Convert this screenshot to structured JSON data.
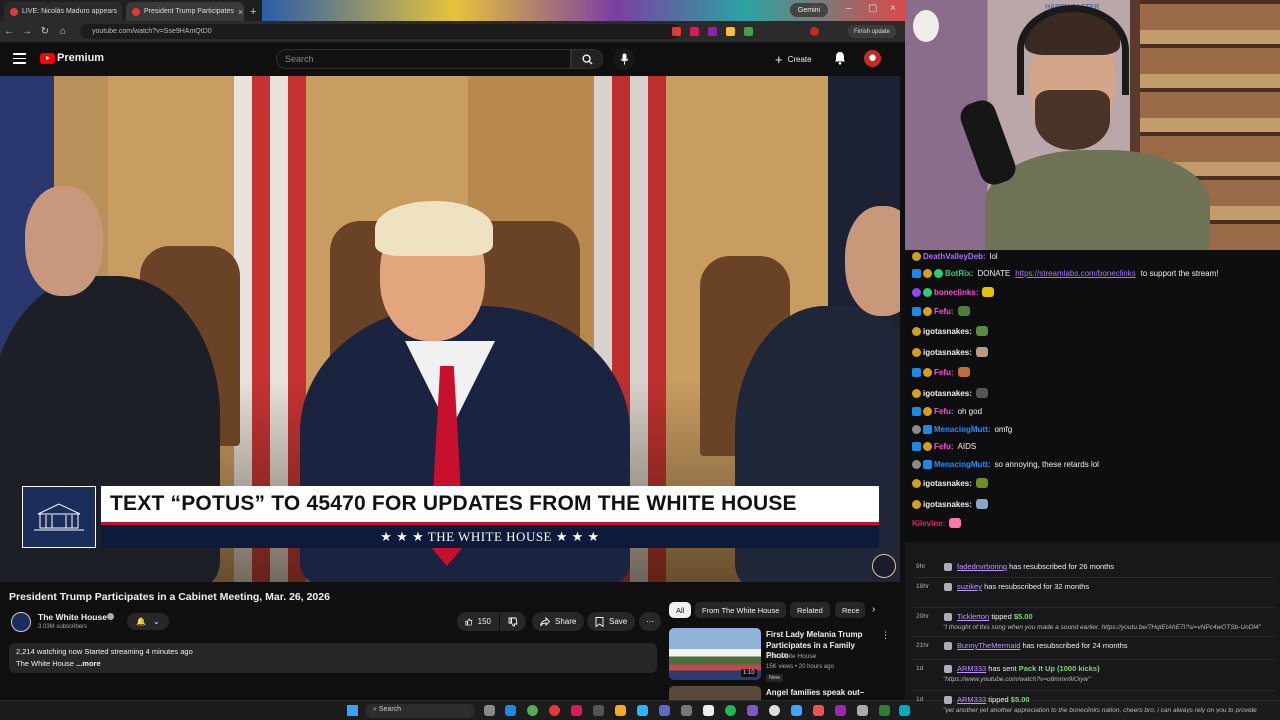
{
  "browser": {
    "tabs": [
      {
        "label": "LIVE: Nicolás Maduro appears",
        "active": false
      },
      {
        "label": "President Trump Participates",
        "active": true
      }
    ],
    "url": "youtube.com/watch?v=Sse9HAmQtD0",
    "gemini_label": "Gemini",
    "finish_update_label": "Finish update"
  },
  "youtube": {
    "brand": "Premium",
    "search_placeholder": "Search",
    "create_label": "Create"
  },
  "video": {
    "banner_text": "TEXT “POTUS” TO 45470 FOR UPDATES FROM THE WHITE HOUSE",
    "banner_subtext": "★ ★ ★   THE WHITE HOUSE   ★ ★ ★",
    "title": "President Trump Participates in a Cabinet Meeting, Mar. 26, 2026",
    "channel": "The White House",
    "subscribers": "3.03M subscribers",
    "like_count": "150",
    "share_label": "Share",
    "save_label": "Save",
    "watching": "2,214 watching now  Started streaming 4 minutes ago",
    "desc_channel": "The White House",
    "desc_more": "...more"
  },
  "related": {
    "chips": [
      "All",
      "From The White House",
      "Related",
      "Rece"
    ],
    "items": [
      {
        "title": "First Lady Melania Trump Participates in a Family Photo",
        "channel": "The White House",
        "meta": "15K views • 20 hours ago",
        "badge": "New",
        "duration": "1:10"
      },
      {
        "title": "Angel families speak out–"
      }
    ]
  },
  "taskbar": {
    "search_label": "Search"
  },
  "webcam": {
    "sign": "HAPPY EASTER"
  },
  "chat": {
    "messages": [
      {
        "user": "DeathValleyDeb:",
        "user_color": "#a970ff",
        "text": "lol",
        "badges": [
          "gold"
        ]
      },
      {
        "user": "BotRix:",
        "user_color": "#2ecc71",
        "text": "DONATE",
        "link": "https://streamlabs.com/boneclinks",
        "after": "to support the stream!",
        "badges": [
          "blue",
          "gold",
          "green"
        ]
      },
      {
        "user": "boneclinks:",
        "user_color": "#ff4ad8",
        "text": "",
        "badges": [
          "purple",
          "green"
        ],
        "emote": "#e6c200"
      },
      {
        "user": "Fefu:",
        "user_color": "#ff4ad8",
        "text": "",
        "badges": [
          "blue",
          "gold"
        ],
        "emote": "#4e7d3a"
      },
      {
        "user": "igotasnakes:",
        "user_color": "#efeff1",
        "text": "",
        "badges": [
          "gold"
        ],
        "emote": "#5a8d3b"
      },
      {
        "user": "igotasnakes:",
        "user_color": "#efeff1",
        "text": "",
        "badges": [
          "gold"
        ],
        "emote": "#b79c8a"
      },
      {
        "user": "Fefu:",
        "user_color": "#ff4ad8",
        "text": "",
        "badges": [
          "blue",
          "gold"
        ],
        "emote": "#c46a3a"
      },
      {
        "user": "igotasnakes:",
        "user_color": "#efeff1",
        "text": "",
        "badges": [
          "gold"
        ],
        "emote": "#555555"
      },
      {
        "user": "Fefu:",
        "user_color": "#ff4ad8",
        "text": "oh god",
        "badges": [
          "blue",
          "gold"
        ]
      },
      {
        "user": "MenacingMutt:",
        "user_color": "#1e90ff",
        "text": "omfg",
        "badges": [
          "gray",
          "blue"
        ]
      },
      {
        "user": "Fefu:",
        "user_color": "#ff4ad8",
        "text": "AIDS",
        "badges": [
          "blue",
          "gold"
        ]
      },
      {
        "user": "MenacingMutt:",
        "user_color": "#1e90ff",
        "text": "so annoying, these retards lol",
        "badges": [
          "gray",
          "blue"
        ]
      },
      {
        "user": "igotasnakes:",
        "user_color": "#efeff1",
        "text": "",
        "badges": [
          "gold"
        ],
        "emote": "#6b8e23"
      },
      {
        "user": "igotasnakes:",
        "user_color": "#efeff1",
        "text": "",
        "badges": [
          "gold"
        ],
        "emote": "#8aa6c8"
      },
      {
        "user": "Kilevine:",
        "user_color": "#e91e63",
        "text": "",
        "badges": [],
        "emote": "#ff77aa"
      }
    ]
  },
  "events": [
    {
      "time": "9hr",
      "user": "fadednvrboring",
      "text": "has resubscribed for 26 months"
    },
    {
      "time": "18hr",
      "user": "suzikey",
      "text": "has resubscribed for 32 months"
    },
    {
      "time": "20hr",
      "user": "Ticklerton",
      "text": "tipped",
      "amount": "$5.00",
      "subline": "\"I thought of this song when you made a sound earlier. https://youtu.be/7HqIEtAhE7I?si=vNPc4wOTSb-UnDl4\""
    },
    {
      "time": "21hr",
      "user": "BunnyTheMermaid",
      "text": "has resubscribed for 24 months"
    },
    {
      "time": "1d",
      "user": "ARM333",
      "text": "has sent",
      "amount": "Pack It Up (1000 kicks)",
      "subline": "\"https://www.youtube.com/watch?v=u8mmn9lOiyw\""
    },
    {
      "time": "1d",
      "user": "ARM333",
      "text": "tipped",
      "amount": "$5.00",
      "subline": "\"yet another yet another appreciation to the boneclinks nation, cheers bro, i can always rely on you to provide entertainment when i need it, thanks bro\""
    }
  ]
}
